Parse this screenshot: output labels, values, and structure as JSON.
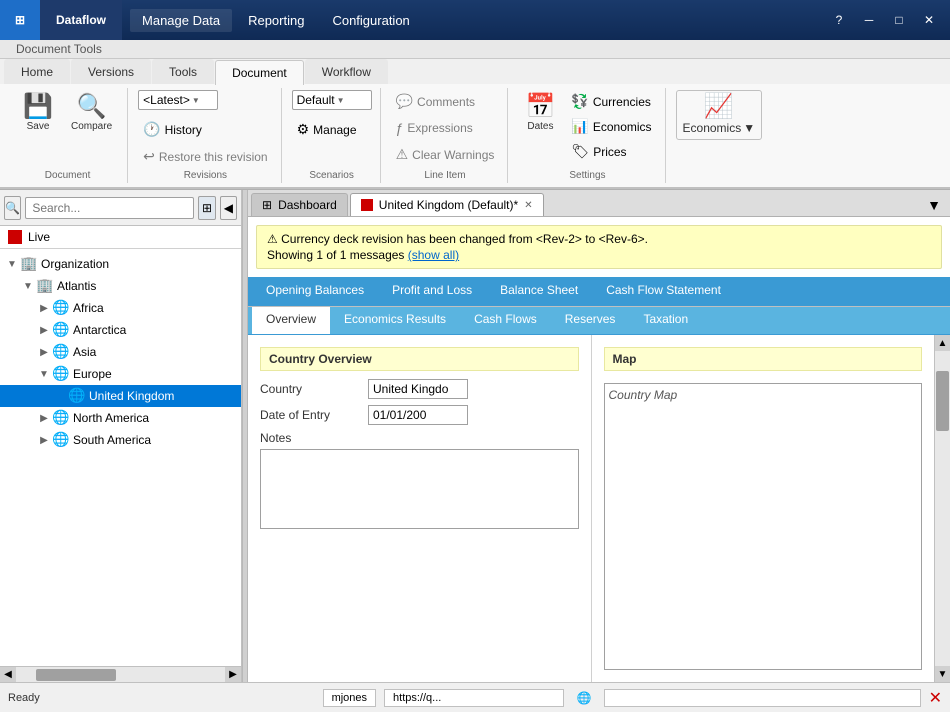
{
  "titleBar": {
    "logoText": "⊞",
    "appName": "Dataflow",
    "menuItems": [
      "Manage Data",
      "Reporting",
      "Configuration"
    ],
    "activeMenu": "Manage Data",
    "controls": {
      "help": "?",
      "minimize": "─",
      "maximize": "□",
      "close": "✕"
    }
  },
  "ribbon": {
    "contextLabel": "Document Tools",
    "tabs": [
      "Home",
      "Versions",
      "Tools",
      "Document",
      "Workflow"
    ],
    "activeTab": "Document",
    "groups": {
      "document": {
        "label": "Document",
        "saveLabel": "Save",
        "compareLabel": "Compare"
      },
      "revisions": {
        "label": "Revisions",
        "dropdown": "<Latest>",
        "historyLabel": "History",
        "restoreLabel": "Restore this revision"
      },
      "scenarios": {
        "label": "Scenarios",
        "dropdown": "Default",
        "manageLabel": "Manage"
      },
      "lineItem": {
        "label": "Line Item",
        "commentsLabel": "Comments",
        "expressionsLabel": "Expressions",
        "clearWarningsLabel": "Clear Warnings"
      },
      "settings": {
        "label": "Settings",
        "datesLabel": "Dates",
        "currenciesLabel": "Currencies",
        "economicsLabel": "Economics",
        "pricesLabel": "Prices"
      },
      "economics": {
        "label": "Economics"
      }
    }
  },
  "navToolbar": {
    "backIcon": "◀",
    "searchPlaceholder": "Search...",
    "searchIcon": "🔍"
  },
  "tree": {
    "liveLabel": "Live",
    "items": [
      {
        "id": "organization",
        "label": "Organization",
        "level": 0,
        "expanded": true,
        "icon": "🏢",
        "hasChildren": true
      },
      {
        "id": "atlantis",
        "label": "Atlantis",
        "level": 1,
        "expanded": true,
        "icon": "🏢",
        "hasChildren": true
      },
      {
        "id": "africa",
        "label": "Africa",
        "level": 2,
        "expanded": false,
        "icon": "🌐",
        "hasChildren": true
      },
      {
        "id": "antarctica",
        "label": "Antarctica",
        "level": 2,
        "expanded": false,
        "icon": "🌐",
        "hasChildren": true
      },
      {
        "id": "asia",
        "label": "Asia",
        "level": 2,
        "expanded": false,
        "icon": "🌐",
        "hasChildren": true
      },
      {
        "id": "europe",
        "label": "Europe",
        "level": 2,
        "expanded": true,
        "icon": "🌐",
        "hasChildren": true
      },
      {
        "id": "united-kingdom",
        "label": "United Kingdom",
        "level": 3,
        "expanded": false,
        "icon": "🌐",
        "hasChildren": false,
        "selected": true
      },
      {
        "id": "north-america",
        "label": "North America",
        "level": 2,
        "expanded": false,
        "icon": "🌐",
        "hasChildren": true
      },
      {
        "id": "south-america",
        "label": "South America",
        "level": 2,
        "expanded": false,
        "icon": "🌐",
        "hasChildren": true
      }
    ]
  },
  "docTabs": [
    {
      "id": "dashboard",
      "label": "Dashboard",
      "icon": "dashboard",
      "active": false,
      "closeable": false
    },
    {
      "id": "united-kingdom",
      "label": "United Kingdom (Default)*",
      "icon": "red-square",
      "active": true,
      "closeable": true
    }
  ],
  "tabDropdown": "▼",
  "warning": {
    "icon": "⚠",
    "text": "Currency deck revision has been changed from <Rev-2> to <Rev-6>.",
    "subText": "Showing 1 of 1 messages",
    "linkText": "(show all)"
  },
  "innerTabs": {
    "row1": [
      {
        "label": "Opening Balances",
        "active": false
      },
      {
        "label": "Profit and Loss",
        "active": false
      },
      {
        "label": "Balance Sheet",
        "active": false
      },
      {
        "label": "Cash Flow Statement",
        "active": false
      }
    ],
    "row2": [
      {
        "label": "Overview",
        "active": true
      },
      {
        "label": "Economics Results",
        "active": false
      },
      {
        "label": "Cash Flows",
        "active": false
      },
      {
        "label": "Reserves",
        "active": false
      },
      {
        "label": "Taxation",
        "active": false
      }
    ]
  },
  "form": {
    "leftSection": {
      "title": "Country Overview",
      "fields": [
        {
          "label": "Country",
          "value": "United Kingdo"
        },
        {
          "label": "Date of Entry",
          "value": "01/01/200"
        }
      ],
      "notesLabel": "Notes"
    },
    "rightSection": {
      "title": "Map",
      "mapLabel": "Country Map"
    }
  },
  "statusBar": {
    "text": "Ready",
    "user": "mjones",
    "url": "https://q...",
    "globeIcon": "🌐",
    "closeIcon": "✕"
  }
}
